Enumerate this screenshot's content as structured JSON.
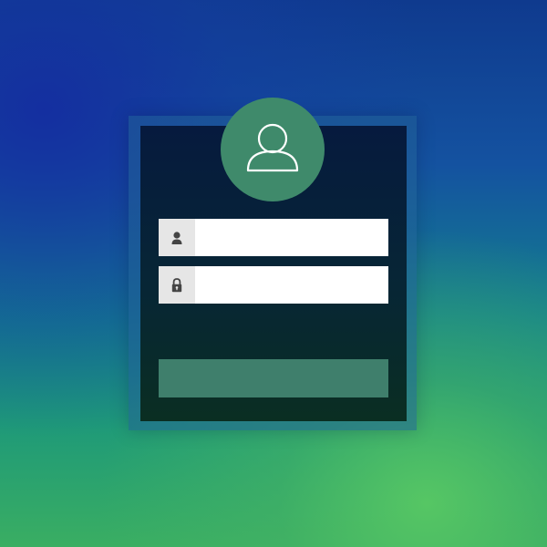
{
  "colors": {
    "accent": "#3f8a6b",
    "button": "#3f7f6c",
    "card_top": "#061a3e",
    "card_bottom": "#0a2e22",
    "field_bg": "#ffffff",
    "icon_box_bg": "#e6e6e6"
  },
  "avatar": {
    "icon": "user-icon"
  },
  "username_field": {
    "icon": "user-icon",
    "value": "",
    "placeholder": ""
  },
  "password_field": {
    "icon": "lock-icon",
    "value": "",
    "placeholder": ""
  },
  "submit": {
    "label": ""
  }
}
